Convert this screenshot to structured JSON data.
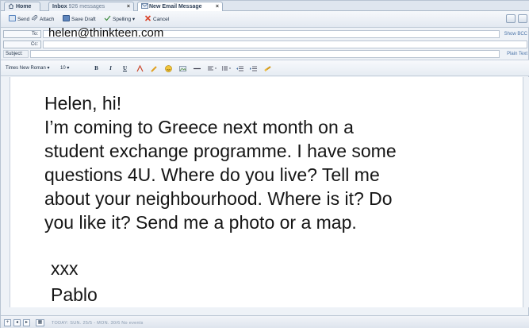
{
  "tabs": [
    {
      "label": "Home",
      "extra": ""
    },
    {
      "label": "Inbox",
      "extra": "926 messages"
    },
    {
      "label": "New Email Message",
      "extra": ""
    }
  ],
  "tab_close_glyph": "×",
  "toolbar": {
    "send_label": "Send",
    "attach_label": "Attach",
    "save_draft_label": "Save Draft",
    "spelling_label": "Spelling ▾",
    "cancel_label": "Cancel"
  },
  "header": {
    "to_label": "To:",
    "to_value": "helen@thinkteen.com",
    "cc_label": "Cc:",
    "subject_label": "Subject:",
    "show_bcc": "Show BCC",
    "plain_text": "Plain Text"
  },
  "format": {
    "font_family": "Times New Roman ▾",
    "font_size": "10 ▾",
    "bold": "B",
    "italic": "I",
    "underline": "U"
  },
  "body": {
    "lines": [
      "Helen, hi!",
      "I’m coming to Greece next month on a",
      "student exchange programme. I have some",
      "questions 4U. Where do you live? Tell me",
      "about your neighbourhood. Where is it? Do",
      "you like it? Send me a photo or a map."
    ],
    "sign_off": "xxx",
    "signature": "Pablo"
  },
  "status": {
    "text": "TODAY: SUN. 25/5 - MON. 30/6  No events"
  },
  "colors": {
    "accent": "#4b74a8",
    "cancel_red": "#d9452b",
    "send_blue": "#5a86c0"
  }
}
